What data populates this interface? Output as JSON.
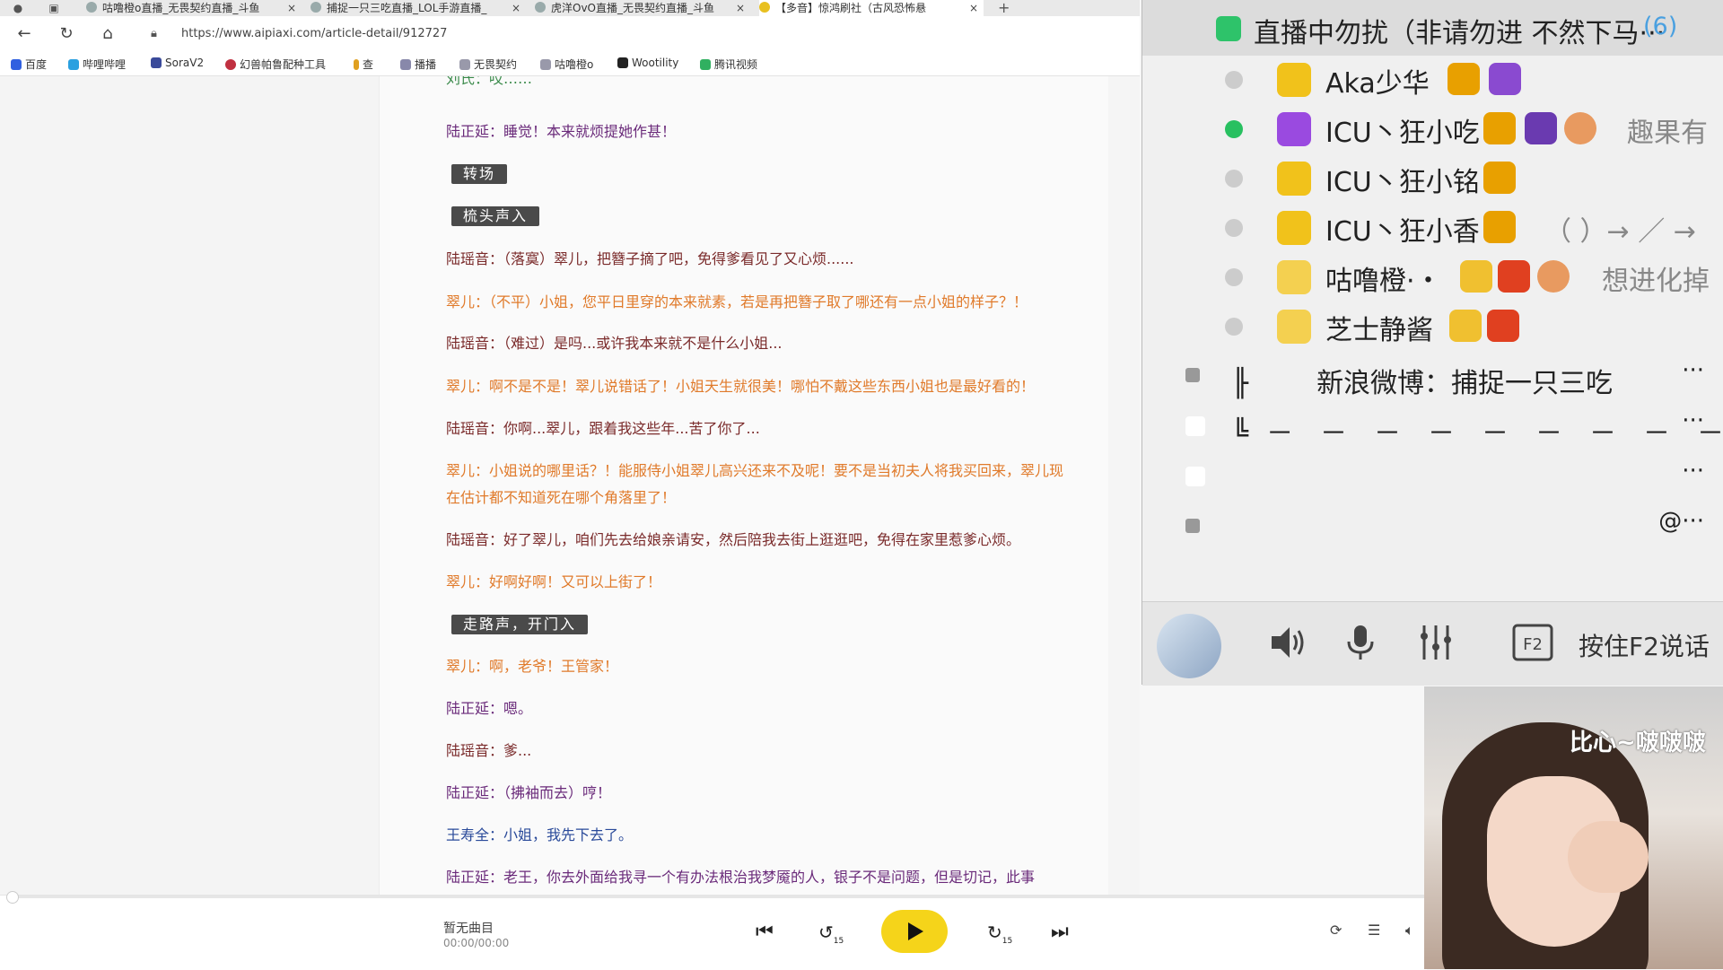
{
  "browser": {
    "tabs": [
      {
        "title": "咕噜橙o直播_无畏契约直播_斗鱼",
        "active": false
      },
      {
        "title": "捕捉一只三吃直播_LOL手游直播_",
        "active": false
      },
      {
        "title": "虎洋OvO直播_无畏契约直播_斗鱼",
        "active": false
      },
      {
        "title": "【多音】惊鸿刷社（古风恐怖悬",
        "active": true
      }
    ],
    "url": "https://www.aipiaxi.com/article-detail/912727",
    "bookmarks": [
      "百度",
      "哔哩哔哩",
      "SoraV2",
      "幻兽帕鲁配种工具",
      "查",
      "播播",
      "无畏契约",
      "咕噜橙o",
      "Wootility",
      "腾讯视频"
    ]
  },
  "article": {
    "top_fragment": "刘氏：哎……",
    "lines": [
      {
        "kind": "text",
        "speaker": "陆正延",
        "text": "陆正延：睡觉！本来就烦提她作甚！",
        "color": "purple"
      },
      {
        "kind": "tag",
        "text": "转场"
      },
      {
        "kind": "tag",
        "text": "梳头声入"
      },
      {
        "kind": "text",
        "text": "陆瑶音：（落寞）翠儿，把簪子摘了吧，免得爹看见了又心烦......",
        "color": "lu"
      },
      {
        "kind": "text",
        "text": "翠儿：（不平）小姐，您平日里穿的本来就素，若是再把簪子取了哪还有一点小姐的样子？！",
        "color": "cui"
      },
      {
        "kind": "text",
        "text": "陆瑶音：（难过）是吗...或许我本来就不是什么小姐...",
        "color": "lu"
      },
      {
        "kind": "text",
        "text": "翠儿：啊不是不是！翠儿说错话了！小姐天生就很美！哪怕不戴这些东西小姐也是最好看的！",
        "color": "cui"
      },
      {
        "kind": "text",
        "text": "陆瑶音：你啊...翠儿，跟着我这些年...苦了你了...",
        "color": "lu"
      },
      {
        "kind": "text",
        "text": "翠儿：小姐说的哪里话？！能服侍小姐翠儿高兴还来不及呢！要不是当初夫人将我买回来，翠儿现在估计都不知道死在哪个角落里了！",
        "color": "cui"
      },
      {
        "kind": "text",
        "text": "陆瑶音：好了翠儿，咱们先去给娘亲请安，然后陪我去街上逛逛吧，免得在家里惹爹心烦。",
        "color": "lu"
      },
      {
        "kind": "text",
        "text": "翠儿：好啊好啊！又可以上街了！",
        "color": "cui"
      },
      {
        "kind": "tag",
        "text": "走路声，开门入"
      },
      {
        "kind": "text",
        "text": "翠儿：啊，老爷！王管家！",
        "color": "cui"
      },
      {
        "kind": "text",
        "text": "陆正延：嗯。",
        "color": "purple"
      },
      {
        "kind": "text",
        "text": "陆瑶音：爹...",
        "color": "lu"
      },
      {
        "kind": "text",
        "text": "陆正延：（拂袖而去）哼！",
        "color": "purple"
      },
      {
        "kind": "text",
        "text": "王寿全：小姐，我先下去了。",
        "color": "wang"
      },
      {
        "kind": "text",
        "text": "陆正延：老王，你去外面给我寻一个有办法根治我梦魇的人，银子不是问题，但是切记，此事",
        "color": "purple"
      }
    ]
  },
  "player": {
    "track_title": "暂无曲目",
    "track_time": "00:00/00:00",
    "progress": 0,
    "rewind_label": "15",
    "forward_label": "15"
  },
  "chat": {
    "channel_title": "直播中勿扰（非请勿进 不然下马···",
    "member_count": "(6)",
    "members": [
      {
        "name": "Aka少华",
        "online": false,
        "extra": ""
      },
      {
        "name": "ICU丶狂小吃",
        "online": true,
        "extra": "趣果有"
      },
      {
        "name": "ICU丶狂小铭",
        "online": false,
        "extra": ""
      },
      {
        "name": "ICU丶狂小香",
        "online": false,
        "extra": "（ ）→ ／ →"
      },
      {
        "name": "咕噜橙·・",
        "online": false,
        "extra": "想进化掉"
      },
      {
        "name": "芝士静酱",
        "online": false,
        "extra": ""
      }
    ],
    "system_rows": [
      {
        "prefix": "╟",
        "text": "新浪微博：捕捉一只三吃",
        "more": "···"
      },
      {
        "prefix": "╚",
        "text": "－　－　－　－　－　－　－　－　－",
        "more": "···"
      },
      {
        "prefix": "",
        "text": "",
        "more": "···"
      },
      {
        "prefix": "",
        "text": "",
        "more": "@···"
      }
    ],
    "footer_hint": "按住F2说话",
    "f2_key": "F2"
  },
  "webcam": {
    "caption": "比心~啵啵啵"
  }
}
